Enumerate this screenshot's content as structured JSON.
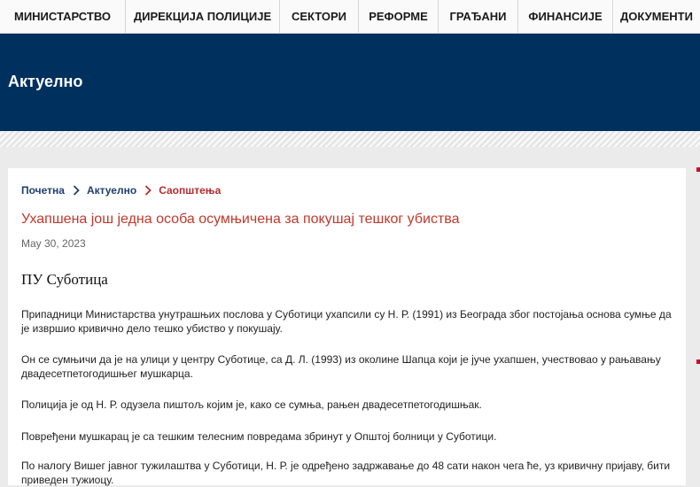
{
  "nav": {
    "items": [
      {
        "label": "МИНИСТАРСТВО"
      },
      {
        "label": "ДИРЕКЦИЈА ПОЛИЦИЈЕ"
      },
      {
        "label": "СЕКТОРИ"
      },
      {
        "label": "РЕФОРМЕ"
      },
      {
        "label": "ГРАЂАНИ"
      },
      {
        "label": "ФИНАНСИЈЕ"
      },
      {
        "label": "ДОКУМЕНТИ"
      }
    ]
  },
  "banner": {
    "title": "Актуелно"
  },
  "breadcrumb": {
    "home": "Почетна",
    "section": "Актуелно",
    "current": "Саопштења",
    "separator_icon": "chevron-right-icon"
  },
  "article": {
    "title": "Ухапшена још једна особа осумњичена за покушај тешког убиства",
    "date": "May 30, 2023",
    "heading": "ПУ Суботица",
    "paragraphs": [
      "Припадници Министарства унутрашњих послова у Суботици ухапсили су Н. Р. (1991) из Београда због постојања основа сумње да је извршио кривично дело тешко убиство у покушају.",
      "Он се сумњичи да је на улици у центру Суботице, са Д. Л. (1993) из околине Шапца који је јуче ухапшен, учествовао у рањавању двадесетпетогодишњег мушкарца.",
      "Полиција је од Н. Р. одузела пиштољ којим је, како се сумња, рањен двадесетпетогодишњак.",
      "Повређени мушкарац је са тешким телесним повредама збринут у Општој болници у Суботици.",
      "По налогу Вишег јавног тужилаштва у Суботици, Н. Р. је одређено задржавање до 48 сати након чега ће, уз кривичну пријаву, бити приведен тужиоцу."
    ]
  },
  "colors": {
    "banner": "#00305e",
    "title": "#c0392b",
    "breadcrumb_link": "#1e3f6e",
    "breadcrumb_current": "#b32d2e",
    "accent_red": "#c8102e"
  }
}
